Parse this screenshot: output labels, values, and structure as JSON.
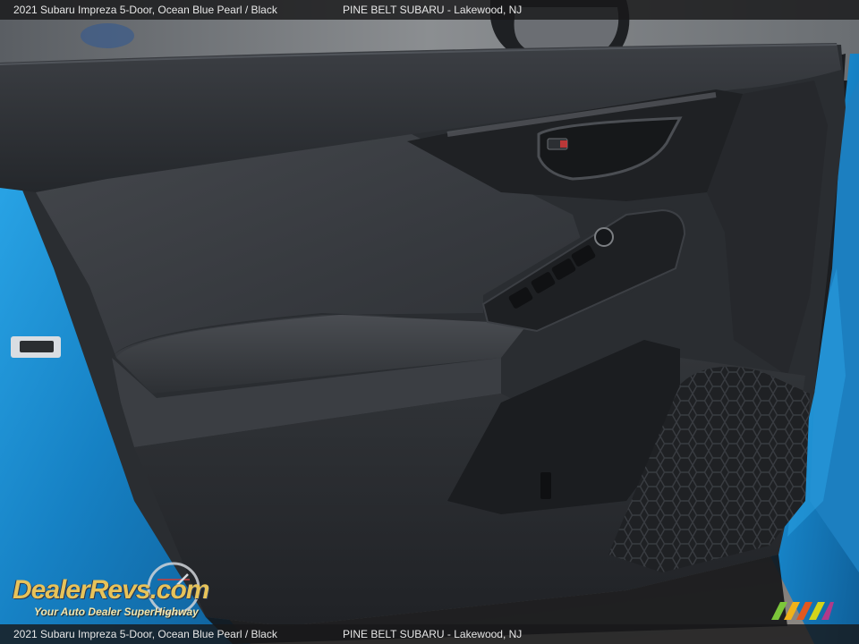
{
  "caption": {
    "vehicle": "2021 Subaru Impreza 5-Door,  Ocean Blue Pearl / Black",
    "dealer": "PINE BELT SUBARU - Lakewood, NJ"
  },
  "watermark": {
    "brand": "DealerRevs.com",
    "tagline": "Your Auto Dealer SuperHighway"
  },
  "colors": {
    "body_paint": "#1d8fd3",
    "trim_dark": "#2c2f33",
    "panel_fabric": "#3a3d42",
    "watermark_gold": "#e7c35a"
  }
}
